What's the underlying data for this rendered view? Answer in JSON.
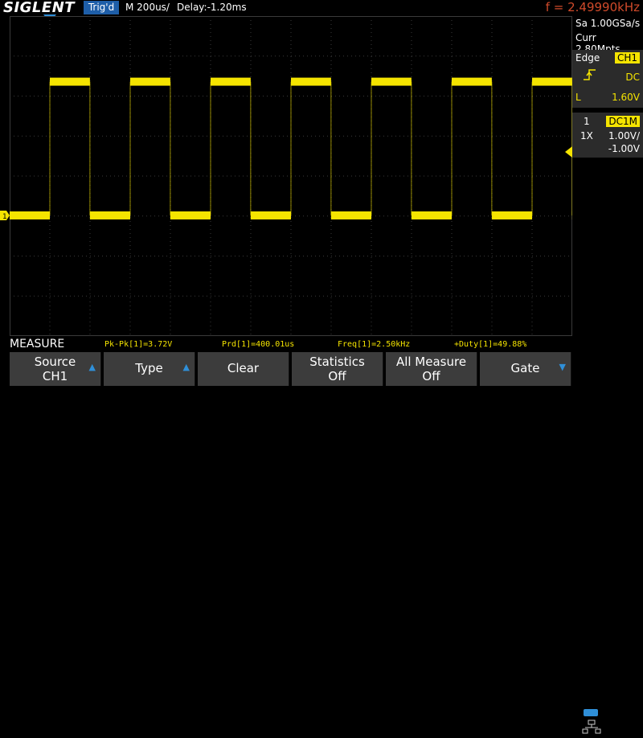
{
  "header": {
    "brand": "SIGLENT",
    "trigger_status": "Trig'd",
    "timebase": "M 200us/",
    "delay": "Delay:-1.20ms",
    "frequency": "f = 2.49990kHz"
  },
  "acquisition": {
    "sample_rate": "Sa 1.00GSa/s",
    "memory_depth": "Curr 2.80Mpts"
  },
  "trigger_panel": {
    "type_label": "Edge",
    "source": "CH1",
    "slope_icon": "rising-edge-icon",
    "coupling": "DC",
    "level_label": "L",
    "level_value": "1.60V"
  },
  "channel_panel": {
    "channel_number": "1",
    "coupling_impedance": "DC1M",
    "probe": "1X",
    "scale": "1.00V/",
    "offset": "-1.00V"
  },
  "measure": {
    "title": "MEASURE",
    "items": [
      "Pk-Pk[1]=3.72V",
      "Prd[1]=400.01us",
      "Freq[1]=2.50kHz",
      "+Duty[1]=49.88%"
    ]
  },
  "softkeys": [
    {
      "line1": "Source",
      "line2": "CH1",
      "has_arrow": true
    },
    {
      "line1": "Type",
      "line2": "",
      "has_arrow": true
    },
    {
      "line1": "Clear",
      "line2": "",
      "has_arrow": false
    },
    {
      "line1": "Statistics",
      "line2": "Off",
      "has_arrow": false
    },
    {
      "line1": "All Measure",
      "line2": "Off",
      "has_arrow": false
    },
    {
      "line1": "Gate",
      "line2": "",
      "has_arrow": true
    }
  ],
  "channel_marker": "1",
  "colors": {
    "trace": "#f5e400",
    "grid": "#3a3a3a",
    "accent": "#2f8fd8",
    "frequency": "#d04a2a"
  },
  "waveform": {
    "type": "square",
    "high_level_fraction": 0.205,
    "low_level_fraction": 0.623,
    "duty_cycle": 0.4988,
    "period_divisions": 2
  }
}
